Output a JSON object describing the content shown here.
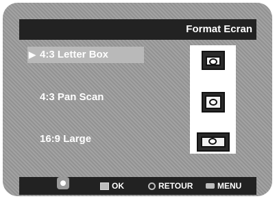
{
  "header": {
    "title": "Format Ecran"
  },
  "menu": {
    "items": [
      {
        "label": "4:3 Letter Box",
        "selected": true
      },
      {
        "label": "4:3 Pan Scan",
        "selected": false
      },
      {
        "label": "16:9 Large",
        "selected": false
      }
    ],
    "selection_marker": "▶"
  },
  "footer": {
    "navigate_icon": "navigate-dpad-icon",
    "ok_label": "OK",
    "return_label": "RETOUR",
    "menu_label": "MENU"
  },
  "colors": {
    "frame": "#9b9b9b",
    "bar": "#222222",
    "selection": "#b9b9b9",
    "text": "#ffffff"
  }
}
